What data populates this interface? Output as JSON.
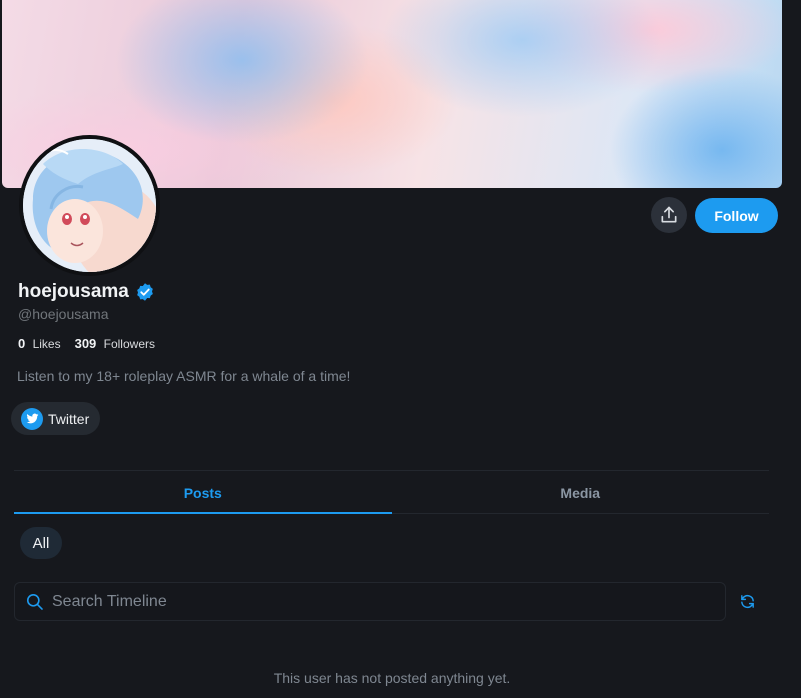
{
  "profile": {
    "display_name": "hoejousama",
    "handle": "@hoejousama",
    "bio": "Listen to my 18+ roleplay ASMR for a whale of a time!",
    "verified": true
  },
  "stats": {
    "likes_count": "0",
    "likes_label": "Likes",
    "followers_count": "309",
    "followers_label": "Followers"
  },
  "actions": {
    "follow_label": "Follow",
    "share_icon": "share-upload-icon"
  },
  "links": {
    "twitter_label": "Twitter",
    "twitter_icon": "twitter-bird-icon"
  },
  "tabs": [
    {
      "label": "Posts",
      "active": true
    },
    {
      "label": "Media",
      "active": false
    }
  ],
  "filters": {
    "selected": "All"
  },
  "search": {
    "placeholder": "Search Timeline"
  },
  "timeline": {
    "empty_message": "This user has not posted anything yet."
  },
  "colors": {
    "accent": "#1d9bf0",
    "background": "#16181d",
    "muted_text": "#7f8791"
  }
}
